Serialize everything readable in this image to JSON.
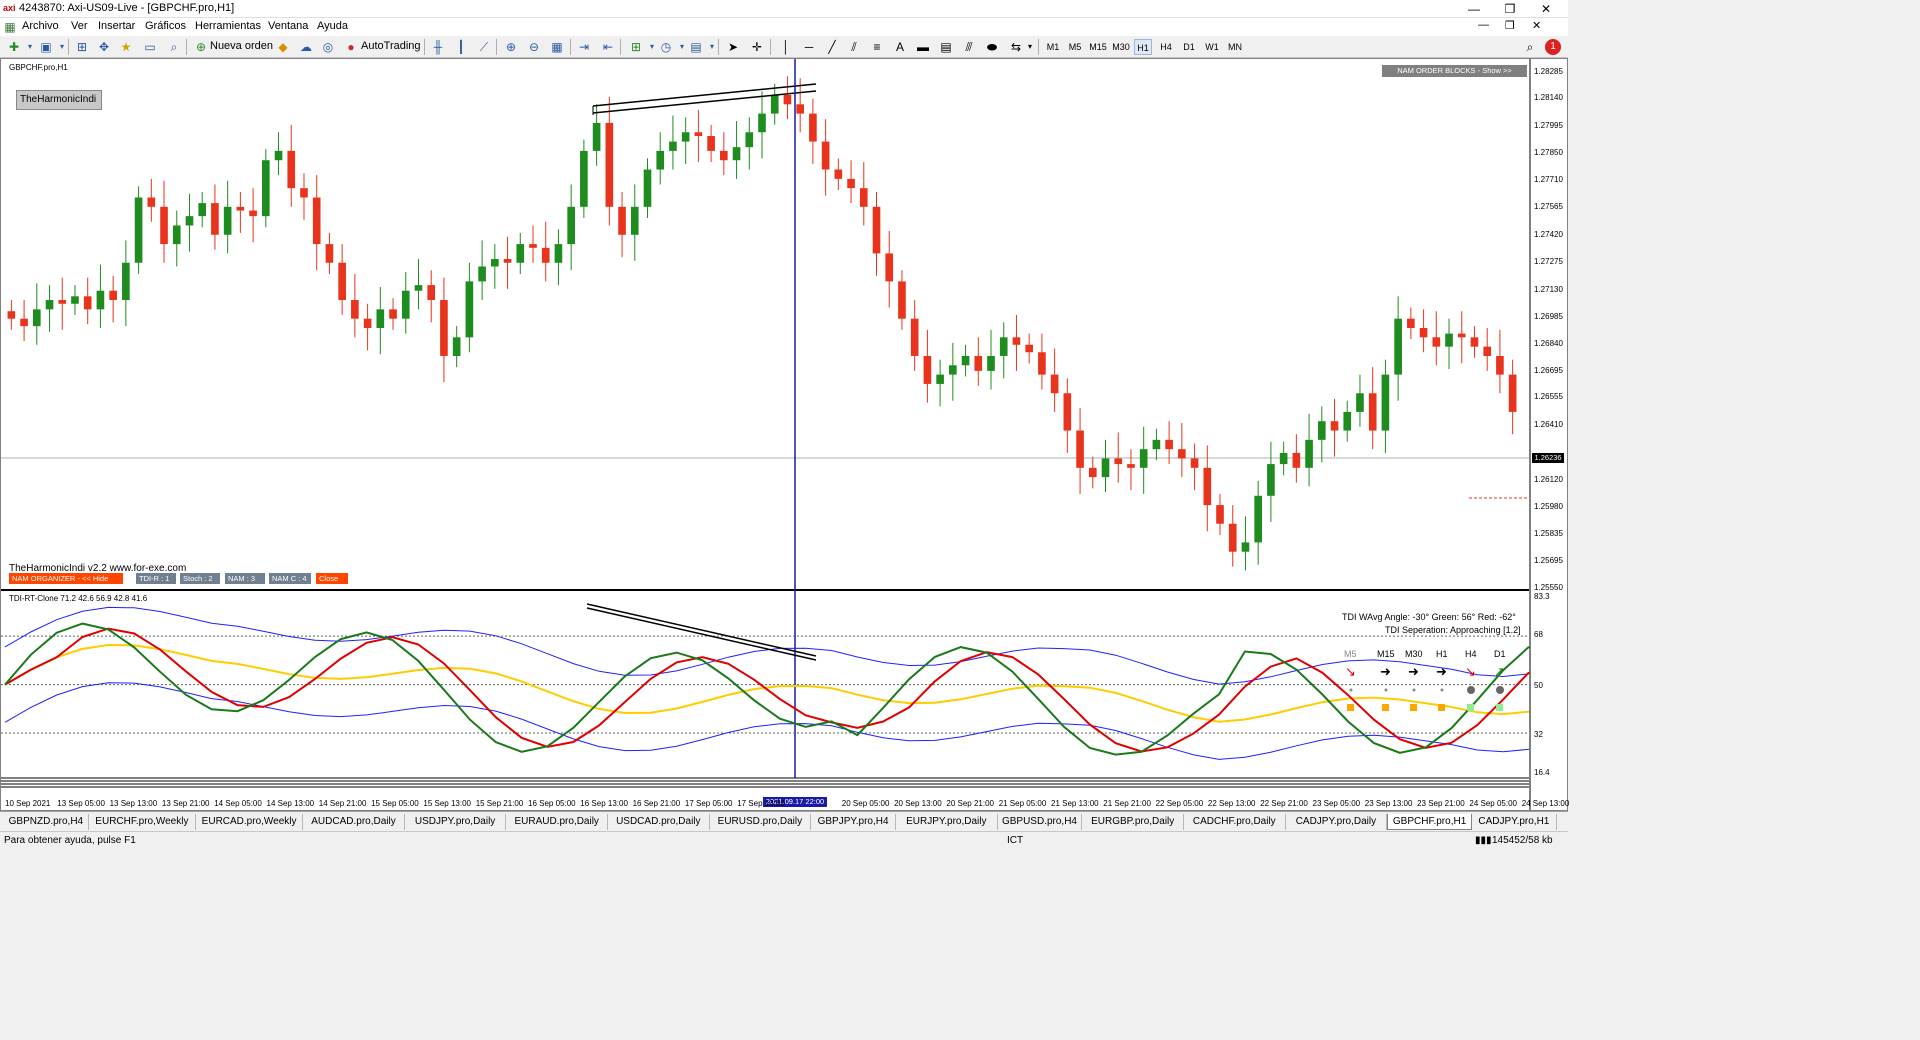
{
  "window": {
    "title": "4243870: Axi-US09-Live - [GBPCHF.pro,H1]",
    "logo": "axi",
    "controls": [
      "—",
      "❐",
      "✕"
    ]
  },
  "menu": [
    "Archivo",
    "Ver",
    "Insertar",
    "Gráficos",
    "Herramientas",
    "Ventana",
    "Ayuda"
  ],
  "toolbar": {
    "new_order": "Nueva orden",
    "autotrading": "AutoTrading",
    "timeframes": [
      "M1",
      "M5",
      "M15",
      "M30",
      "H1",
      "H4",
      "D1",
      "W1",
      "MN"
    ],
    "active_timeframe": "H1",
    "notification_count": "1"
  },
  "chart": {
    "symbol_label": "GBPCHF.pro,H1",
    "harmonic_button": "TheHarmonicIndi",
    "nam_order_blocks": "NAM ORDER BLOCKS - Show >>",
    "watermark": "TheHarmonicIndi v2.2 www.for-exe.com",
    "indicator_buttons": [
      "NAM ORGANIZER - << Hide",
      "TDI-R : 1",
      "Stoch : 2",
      "NAM : 3",
      "NAM C : 4",
      "Close"
    ],
    "current_price": "1.26236",
    "vline_time": "2021.09.17 22:00",
    "tdi_label": "TDI-RT-Clone 71.2 42.6 56.9 42.8 41.6",
    "tdi_info_1": "TDI WAvg Angle: -30°  Green: 56°  Red: -62°",
    "tdi_info_2": "TDI Seperation: Approaching [1.2]",
    "mtf_labels": [
      "M5",
      "M15",
      "M30",
      "H1",
      "H4",
      "D1"
    ],
    "price_axis": [
      "1.28285",
      "1.28140",
      "1.27995",
      "1.27850",
      "1.27710",
      "1.27565",
      "1.27420",
      "1.27275",
      "1.27130",
      "1.26985",
      "1.26840",
      "1.26695",
      "1.26555",
      "1.26410",
      "1.26120",
      "1.25980",
      "1.25835",
      "1.25695",
      "1.25550"
    ],
    "tdi_axis": [
      "83.3",
      "68",
      "50",
      "32",
      "16.4"
    ],
    "time_axis": [
      "10 Sep 2021",
      "13 Sep 05:00",
      "13 Sep 13:00",
      "13 Sep 21:00",
      "14 Sep 05:00",
      "14 Sep 13:00",
      "14 Sep 21:00",
      "15 Sep 05:00",
      "15 Sep 13:00",
      "15 Sep 21:00",
      "16 Sep 05:00",
      "16 Sep 13:00",
      "16 Sep 21:00",
      "17 Sep 05:00",
      "17 Sep 13:00",
      "",
      "20 Sep 05:00",
      "20 Sep 13:00",
      "20 Sep 21:00",
      "21 Sep 05:00",
      "21 Sep 13:00",
      "21 Sep 21:00",
      "22 Sep 05:00",
      "22 Sep 13:00",
      "22 Sep 21:00",
      "23 Sep 05:00",
      "23 Sep 13:00",
      "23 Sep 21:00",
      "24 Sep 05:00",
      "24 Sep 13:00"
    ]
  },
  "tabs": [
    "GBPNZD.pro,H4",
    "EURCHF.pro,Weekly",
    "EURCAD.pro,Weekly",
    "AUDCAD.pro,Daily",
    "USDJPY.pro,Daily",
    "EURAUD.pro,Daily",
    "USDCAD.pro,Daily",
    "EURUSD.pro,Daily",
    "GBPJPY.pro,H4",
    "EURJPY.pro,Daily",
    "GBPUSD.pro,H4",
    "EURGBP.pro,Daily",
    "CADCHF.pro,Daily",
    "CADJPY.pro,Daily",
    "GBPCHF.pro,H1",
    "CADJPY.pro,H1"
  ],
  "active_tab": "GBPCHF.pro,H1",
  "status": {
    "help": "Para obtener ayuda, pulse F1",
    "timezone": "ICT",
    "traffic": "145452/58 kb"
  },
  "colors": {
    "bull": "#1e8c1e",
    "bear": "#e8341c",
    "tdi_green": "#1a7a1a",
    "tdi_red": "#e00000",
    "tdi_yellow": "#ffcc00",
    "tdi_band": "#2020ff",
    "vline": "#1a1aaa"
  },
  "chart_data": {
    "type": "candlestick",
    "symbol": "GBPCHF.pro",
    "timeframe": "H1",
    "ylim": [
      1.2555,
      1.2835
    ],
    "close_series": [
      1.27,
      1.2696,
      1.2705,
      1.271,
      1.2708,
      1.2712,
      1.2705,
      1.2715,
      1.271,
      1.273,
      1.2765,
      1.276,
      1.274,
      1.275,
      1.2755,
      1.2762,
      1.2745,
      1.276,
      1.2758,
      1.2755,
      1.2785,
      1.279,
      1.277,
      1.2765,
      1.274,
      1.273,
      1.271,
      1.27,
      1.2695,
      1.2705,
      1.27,
      1.2715,
      1.2718,
      1.271,
      1.268,
      1.269,
      1.272,
      1.2728,
      1.2732,
      1.273,
      1.274,
      1.2738,
      1.273,
      1.274,
      1.276,
      1.279,
      1.2805,
      1.276,
      1.2745,
      1.276,
      1.278,
      1.279,
      1.2795,
      1.28,
      1.2798,
      1.279,
      1.2785,
      1.2792,
      1.28,
      1.281,
      1.282,
      1.2815,
      1.281,
      1.2795,
      1.278,
      1.2775,
      1.277,
      1.276,
      1.2735,
      1.272,
      1.27,
      1.268,
      1.2665,
      1.267,
      1.2675,
      1.268,
      1.2672,
      1.268,
      1.269,
      1.2686,
      1.2682,
      1.267,
      1.266,
      1.264,
      1.262,
      1.2615,
      1.2625,
      1.2622,
      1.262,
      1.263,
      1.2635,
      1.263,
      1.2625,
      1.262,
      1.26,
      1.259,
      1.2575,
      1.258,
      1.2605,
      1.2622,
      1.2628,
      1.262,
      1.2635,
      1.2645,
      1.264,
      1.265,
      1.266,
      1.264,
      1.267,
      1.27,
      1.2695,
      1.269,
      1.2685,
      1.2692,
      1.269,
      1.2685,
      1.268,
      1.267,
      1.265
    ]
  }
}
